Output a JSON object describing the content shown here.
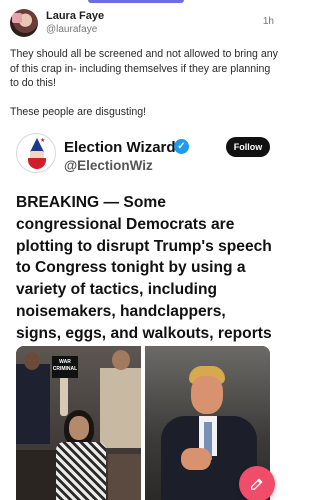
{
  "post": {
    "author": {
      "name": "Laura Faye",
      "handle": "@laurafaye"
    },
    "timestamp": "1h",
    "text_paragraphs": [
      "They should all be screened and not allowed to bring any of this crap in- including themselves if they are planning to do this!",
      "These people are disgusting!"
    ]
  },
  "embedded_tweet": {
    "name": "Election Wizard",
    "handle": "@ElectionWiz",
    "follow_label": "Follow",
    "body": "BREAKING — Some congressional Democrats are plotting to disrupt Trump's speech to Congress tonight by using a variety of tactics, including noisemakers, handclappers, signs, eggs, and walkouts, reports Axios.",
    "photo_sign_text": "WAR CRIMINAL"
  },
  "fab": {
    "icon": "compose-icon"
  },
  "colors": {
    "accent": "#6e6ce8",
    "fab": "#f04d6b",
    "verified": "#1d9bf0"
  }
}
